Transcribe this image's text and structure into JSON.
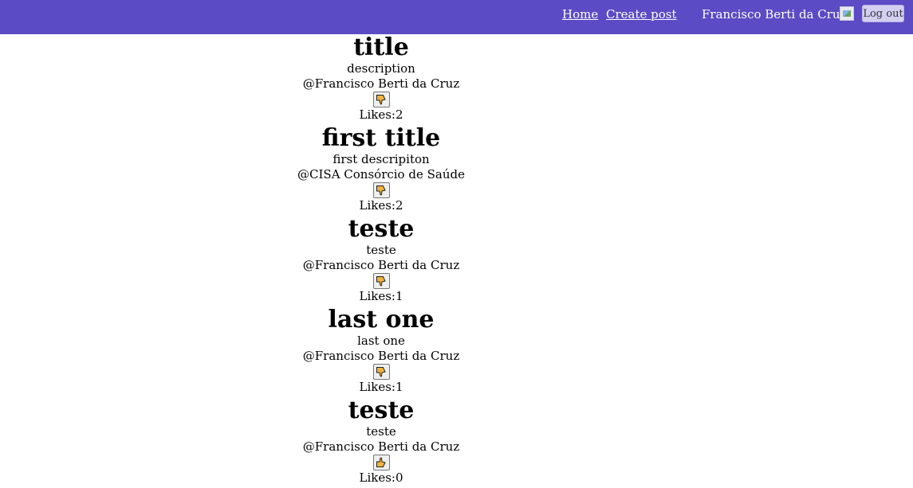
{
  "nav": {
    "home_label": "Home",
    "create_label": "Create post",
    "user_name": "Francisco Berti da Cruz",
    "logout_label": "Log out"
  },
  "likes_prefix": "Likes:",
  "posts": [
    {
      "title": "title",
      "description": "description",
      "author": "@Francisco Berti da Cruz",
      "likes": "2",
      "reaction_icon": "thumbs-down-icon"
    },
    {
      "title": "first title",
      "description": "first descripiton",
      "author": "@CISA Consórcio de Saúde",
      "likes": "2",
      "reaction_icon": "thumbs-down-icon"
    },
    {
      "title": "teste",
      "description": "teste",
      "author": "@Francisco Berti da Cruz",
      "likes": "1",
      "reaction_icon": "thumbs-down-icon"
    },
    {
      "title": "last one",
      "description": "last one",
      "author": "@Francisco Berti da Cruz",
      "likes": "1",
      "reaction_icon": "thumbs-down-icon"
    },
    {
      "title": "teste",
      "description": "teste",
      "author": "@Francisco Berti da Cruz",
      "likes": "0",
      "reaction_icon": "thumbs-up-icon"
    }
  ],
  "colors": {
    "navbar": "#5b4bc4",
    "thumb": "#f2b33d"
  }
}
